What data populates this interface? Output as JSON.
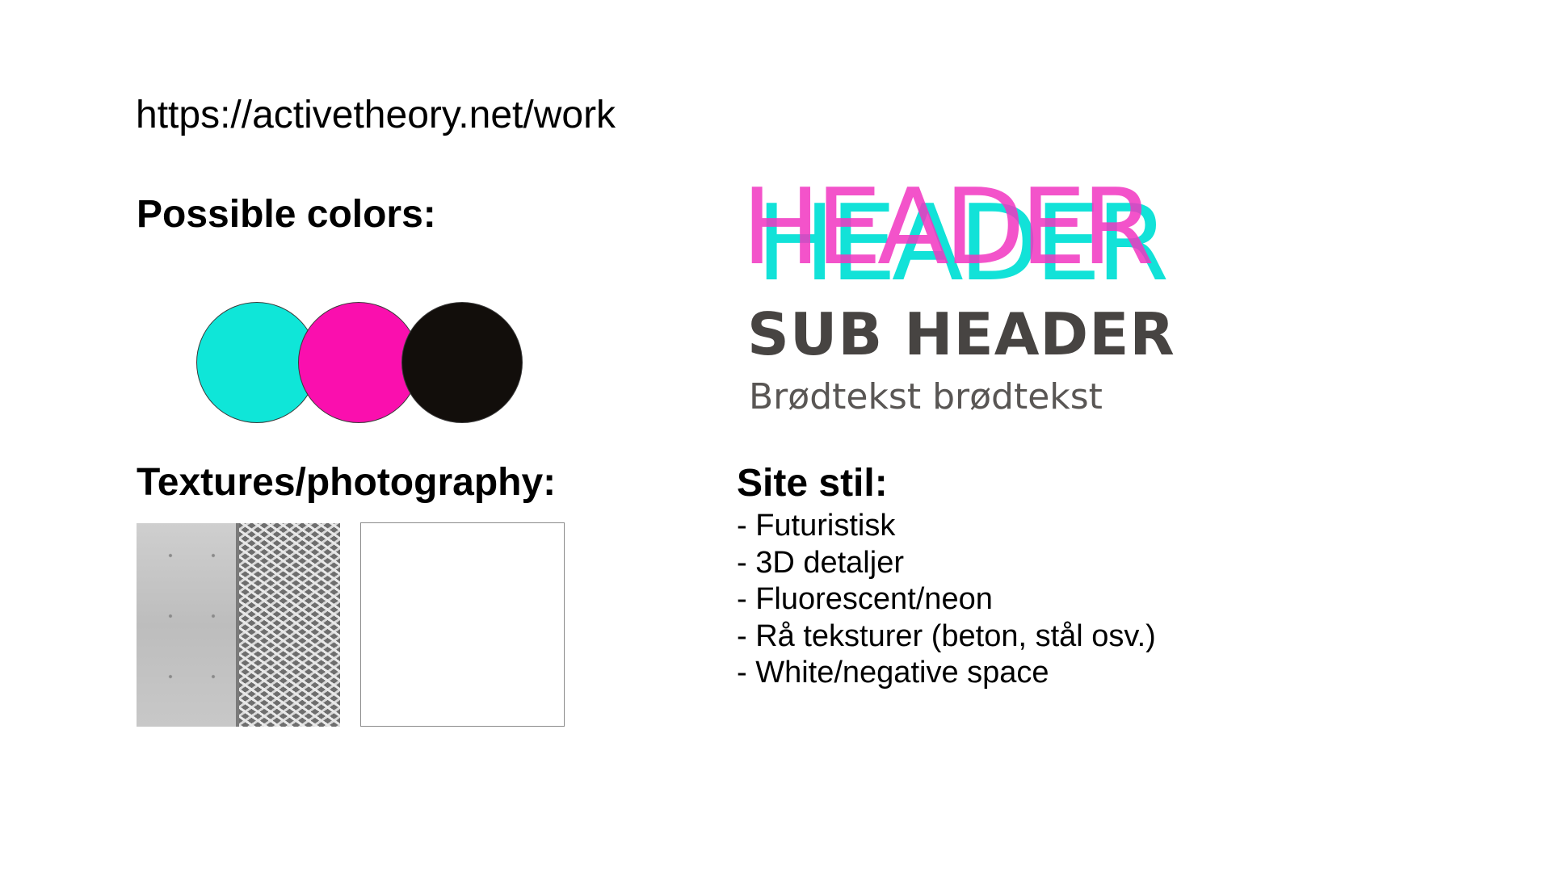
{
  "url_text": "https://activetheory.net/work",
  "colors_heading": "Possible colors:",
  "palette": [
    {
      "name": "cyan",
      "hex": "#0fe6d8"
    },
    {
      "name": "magenta",
      "hex": "#fa0fae"
    },
    {
      "name": "black",
      "hex": "#120e0b"
    }
  ],
  "typography": {
    "header": "HEADER",
    "header_color_front": "#f236c1",
    "header_color_back": "#12e2d8",
    "subheader": "SUB HEADER",
    "subheader_color": "#474442",
    "body": "Brødtekst brødtekst",
    "body_color": "#595654"
  },
  "textures_heading": "Textures/photography:",
  "textures": [
    {
      "name": "concrete-and-metal-mesh"
    },
    {
      "name": "empty-placeholder"
    }
  ],
  "site_style": {
    "heading": "Site stil:",
    "items": [
      "- Futuristisk",
      "- 3D detaljer",
      "- Fluorescent/neon",
      "- Rå teksturer (beton, stål osv.)",
      "- White/negative space"
    ]
  }
}
